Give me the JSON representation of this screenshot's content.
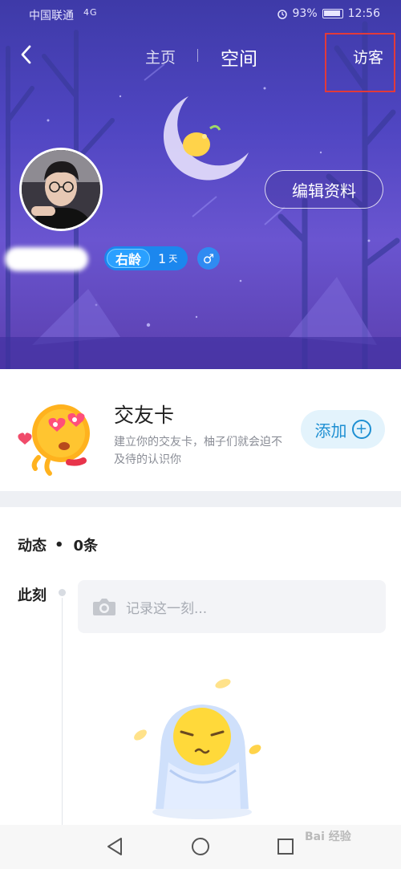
{
  "status_bar": {
    "carrier": "中国联通",
    "signal_text": "4G",
    "battery_percent": "93%",
    "time": "12:56",
    "icons": [
      "signal-icon",
      "wifi-icon",
      "alarm-icon",
      "battery-icon"
    ]
  },
  "nav": {
    "back_icon": "chevron-left-icon",
    "tab_home": "主页",
    "tab_space": "空间",
    "visitors": "访客"
  },
  "profile": {
    "edit_button": "编辑资料",
    "age_tag": "右龄",
    "age_value": "1",
    "age_unit": "天",
    "gender_symbol": "♂"
  },
  "friend_card": {
    "title": "交友卡",
    "description": "建立你的交友卡，柚子们就会迫不及待的认识你",
    "add_button": "添加",
    "add_icon": "plus-circle-icon"
  },
  "feed": {
    "label": "动态",
    "separator": "•",
    "count": "0条",
    "moment_label": "此刻",
    "record_placeholder": "记录这一刻...",
    "camera_icon": "camera-icon"
  },
  "system_nav": {
    "icons": [
      "back-triangle-icon",
      "home-circle-icon",
      "recents-square-icon"
    ]
  },
  "watermark": "Bai 经验",
  "colors": {
    "hero_bg": "#5046c2",
    "accent_blue": "#1d8fd2",
    "highlight_red": "#e23a3a"
  }
}
